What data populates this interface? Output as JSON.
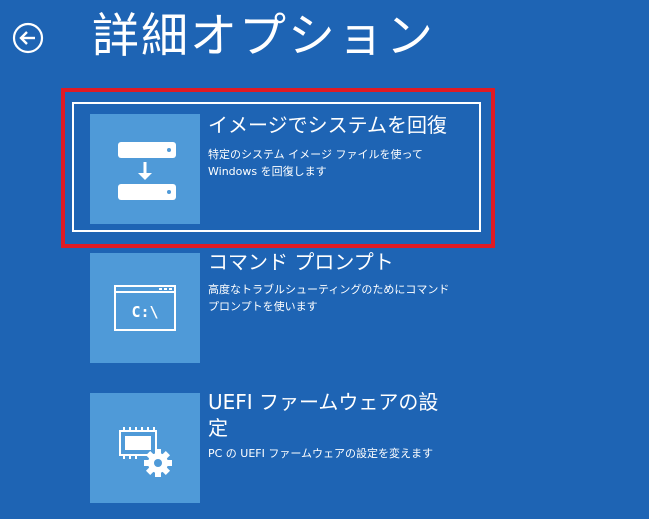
{
  "header": {
    "back_icon": "back-arrow-circle-icon",
    "title": "詳細オプション"
  },
  "options": [
    {
      "icon": "system-image-restore-icon",
      "title": "イメージでシステムを回復",
      "description_lines": [
        "特定のシステム イメージ ファイルを使って",
        "Windows を回復します"
      ]
    },
    {
      "icon": "command-prompt-icon",
      "icon_text": "C:\\",
      "title": "コマンド プロンプト",
      "description_lines": [
        "高度なトラブルシューティングのためにコマンド",
        "プロンプトを使います"
      ]
    },
    {
      "icon": "uefi-firmware-settings-icon",
      "title_lines": [
        "UEFI ファームウェアの設",
        "定"
      ],
      "description_lines": [
        "PC の UEFI ファームウェアの設定を変えます"
      ]
    }
  ],
  "colors": {
    "background": "#1e64b4",
    "tile": "#4f9ad8",
    "text": "#ffffff",
    "focus_outline": "#ffffff",
    "highlight": "#e01b24"
  }
}
